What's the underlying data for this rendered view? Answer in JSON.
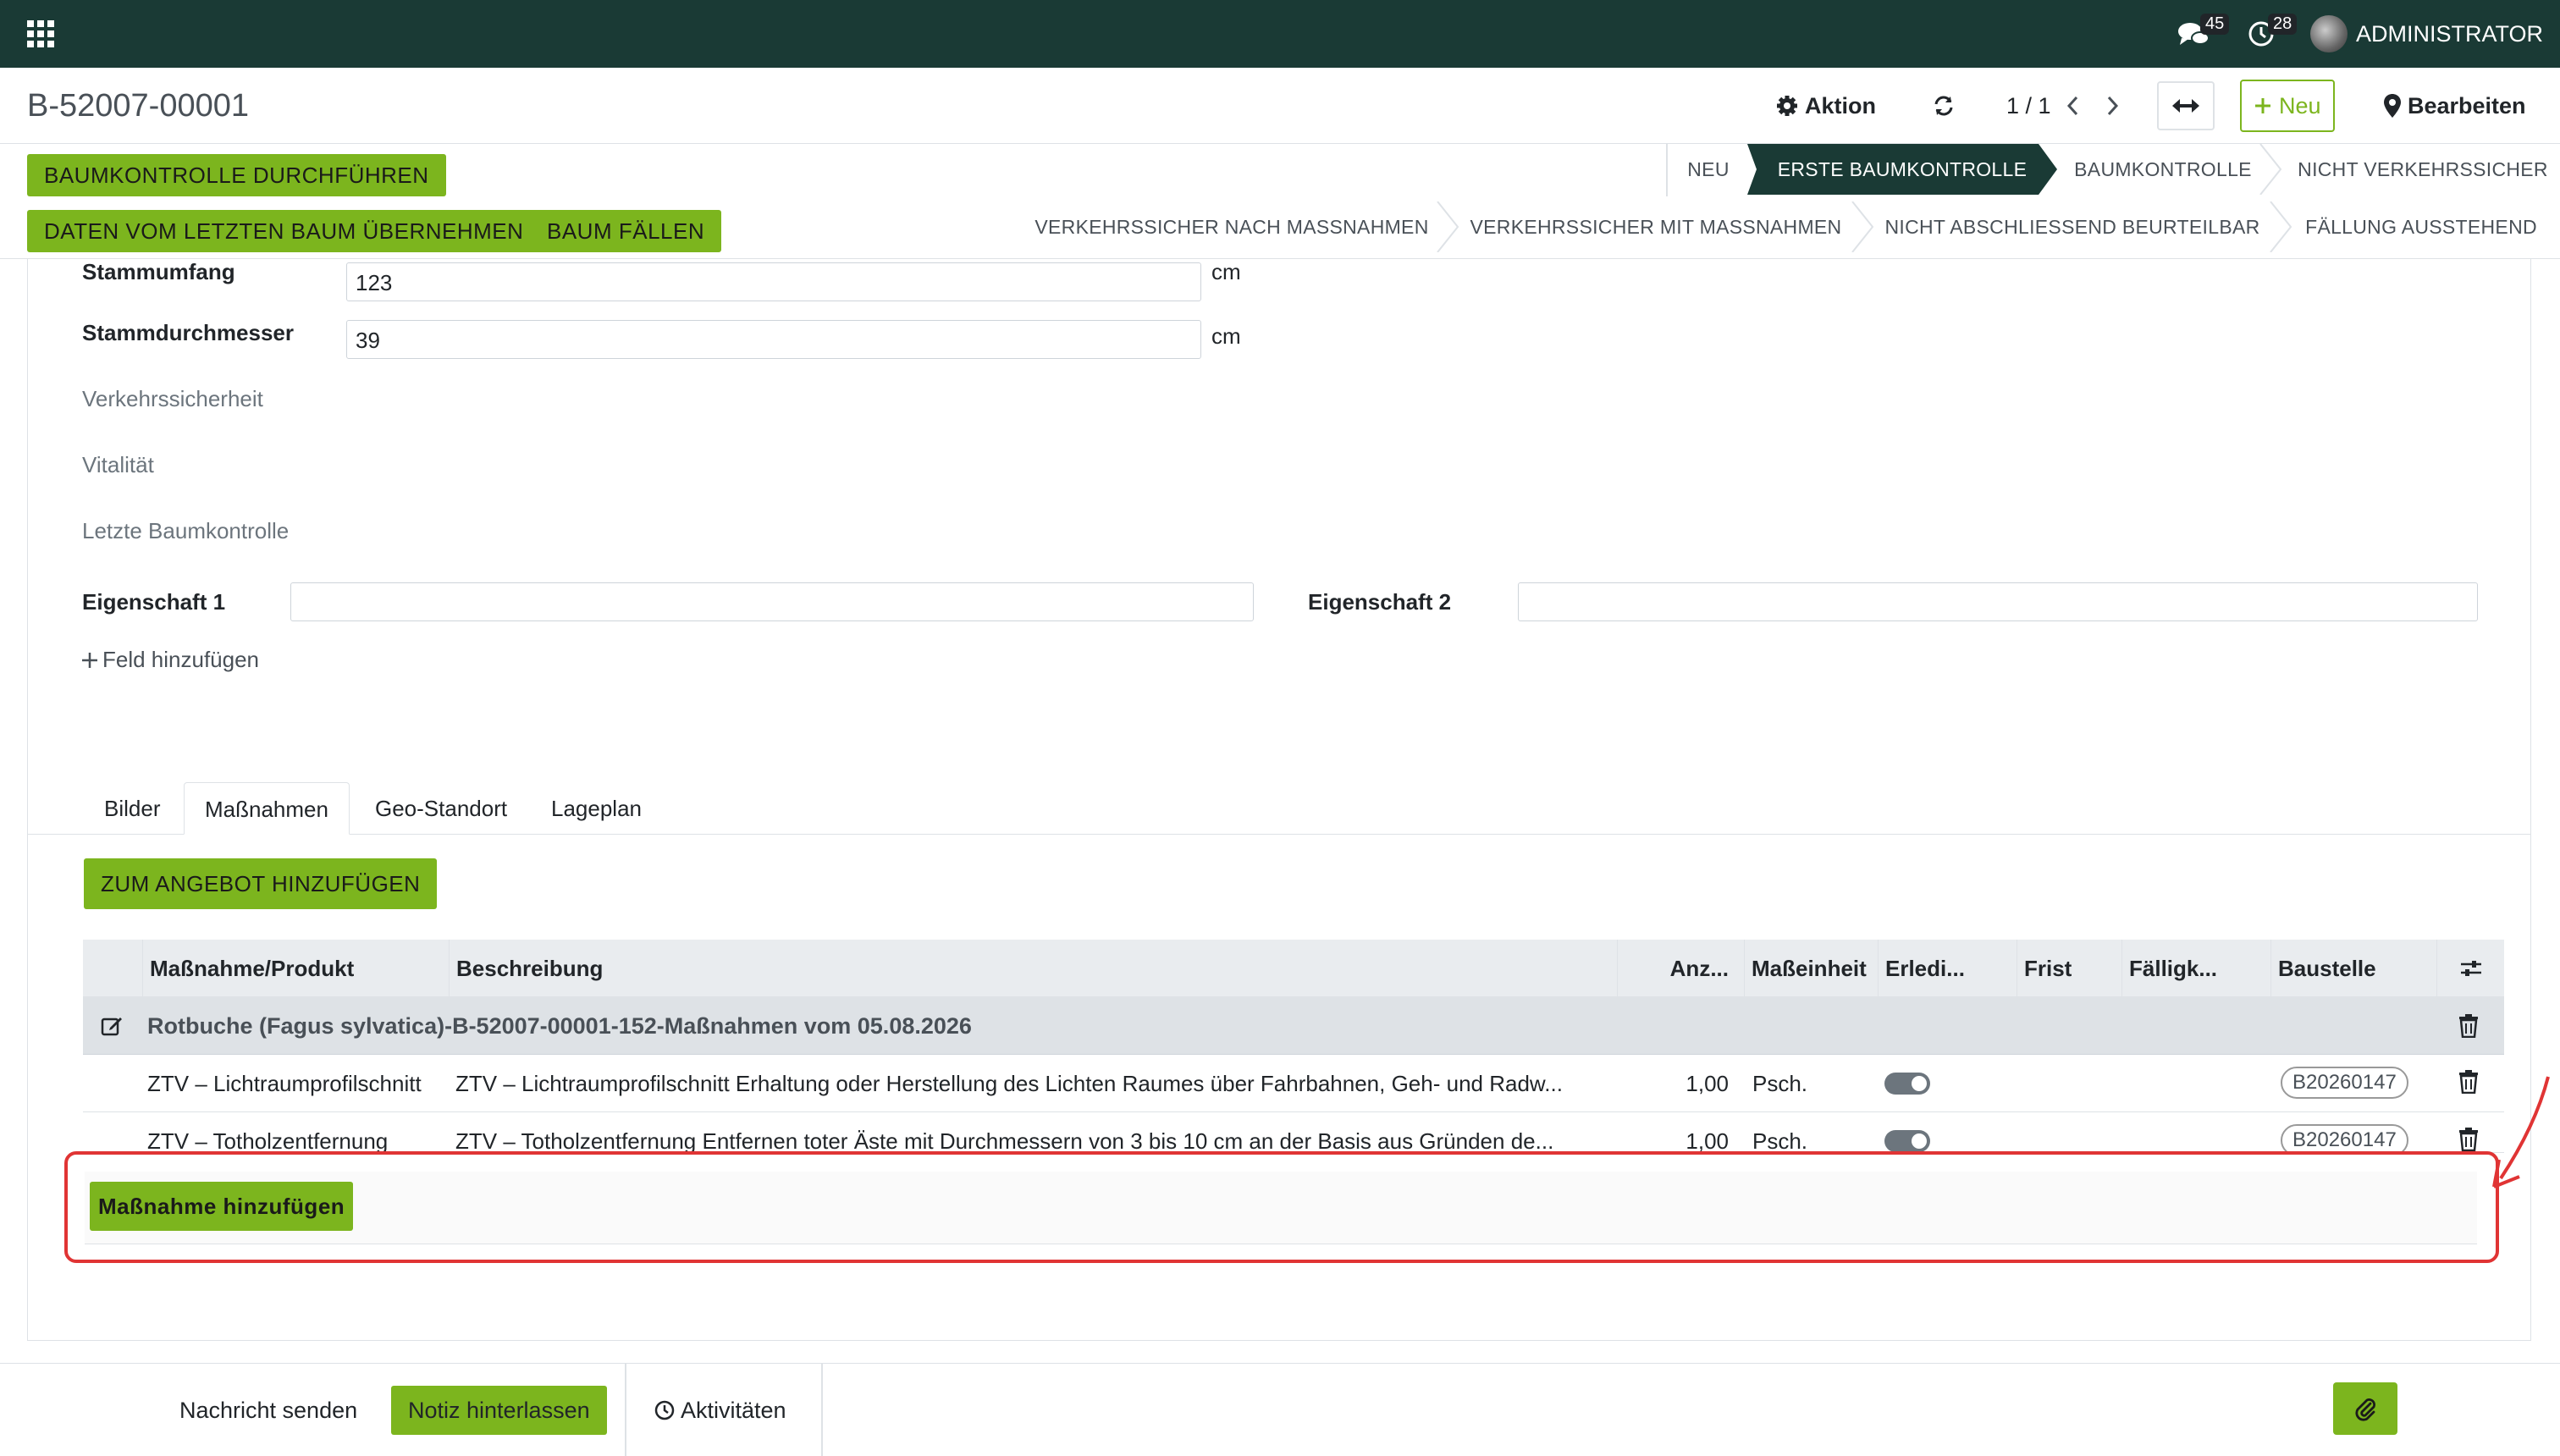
{
  "navbar": {
    "messages_badge": "45",
    "activities_badge": "28",
    "user_name": "ADMINISTRATOR"
  },
  "control_panel": {
    "record_title": "B-52007-00001",
    "action_label": "Aktion",
    "pager": "1 / 1",
    "new_label": "Neu",
    "edit_label": "Bearbeiten"
  },
  "header_buttons": {
    "do_check": "BAUMKONTROLLE DURCHFÜHREN",
    "copy_last": "DATEN VOM LETZTEN BAUM ÜBERNEHMEN",
    "fell_tree": "BAUM FÄLLEN"
  },
  "statusbar": {
    "row1": [
      "NEU",
      "ERSTE BAUMKONTROLLE",
      "BAUMKONTROLLE",
      "NICHT VERKEHRSSICHER"
    ],
    "row2": [
      "VERKEHRSSICHER NACH MASSNAHMEN",
      "VERKEHRSSICHER MIT MASSNAHMEN",
      "NICHT ABSCHLIESSEND BEURTEILBAR",
      "FÄLLUNG AUSSTEHEND"
    ],
    "active": "ERSTE BAUMKONTROLLE"
  },
  "form": {
    "stammumfang_label": "Stammumfang",
    "stammumfang_value": "123",
    "stammumfang_unit": "cm",
    "stammdurchmesser_label": "Stammdurchmesser",
    "stammdurchmesser_value": "39",
    "stammdurchmesser_unit": "cm",
    "verkehrssicherheit_label": "Verkehrssicherheit",
    "vitalitaet_label": "Vitalität",
    "letzte_label": "Letzte Baumkontrolle",
    "eigenschaft1_label": "Eigenschaft 1",
    "eigenschaft1_value": "",
    "eigenschaft2_label": "Eigenschaft 2",
    "eigenschaft2_value": "",
    "add_field": "Feld hinzufügen"
  },
  "tabs": [
    "Bilder",
    "Maßnahmen",
    "Geo-Standort",
    "Lageplan"
  ],
  "active_tab": "Maßnahmen",
  "offer_button": "ZUM ANGEBOT HINZUFÜGEN",
  "table": {
    "headers": [
      "Maßnahme/Produkt",
      "Beschreibung",
      "Anz...",
      "Maßeinheit",
      "Erledi...",
      "Frist",
      "Fälligk...",
      "Baustelle"
    ],
    "section": "Rotbuche (Fagus sylvatica)-B-52007-00001-152-Maßnahmen vom 05.08.2026",
    "rows": [
      {
        "product": "ZTV – Lichtraumprofilschnitt",
        "description": "ZTV – Lichtraumprofilschnitt Erhaltung oder Herstellung des Lichten Raumes über Fahrbahnen, Geh- und Radw...",
        "qty": "1,00",
        "uom": "Psch.",
        "site": "B20260147"
      },
      {
        "product": "ZTV – Totholzentfernung",
        "description": "ZTV – Totholzentfernung Entfernen toter Äste mit Durchmessern von 3 bis 10 cm an der Basis aus Gründen de...",
        "qty": "1,00",
        "uom": "Psch.",
        "site": "B20260147"
      }
    ],
    "add_line": "Maßnahme hinzufügen"
  },
  "chatter": {
    "send_message": "Nachricht senden",
    "log_note": "Notiz hinterlassen",
    "activities": "Aktivitäten"
  },
  "colors": {
    "navbar": "#1a3a35",
    "accent_green": "#7cb51e",
    "highlight_red": "#e03434"
  }
}
